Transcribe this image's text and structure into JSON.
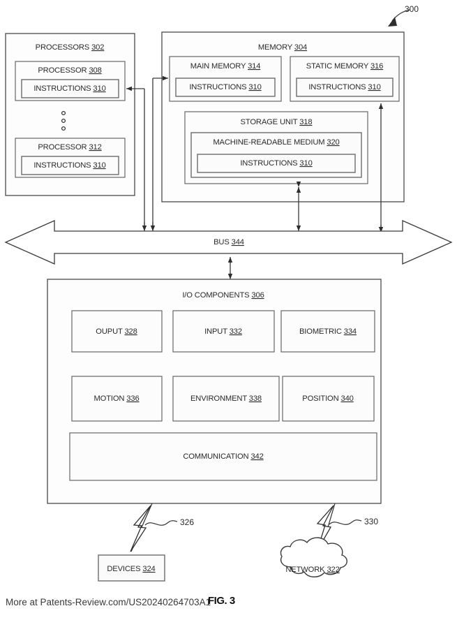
{
  "figure": {
    "id": "300",
    "caption": "FIG. 3",
    "footer_text": "More at Patents-Review.com/US20240264703A1"
  },
  "processors": {
    "title": "PROCESSORS",
    "num": "302",
    "items": [
      {
        "title": "PROCESSOR",
        "num": "308",
        "child": {
          "title": "INSTRUCTIONS",
          "num": "310"
        }
      },
      {
        "title": "PROCESSOR",
        "num": "312",
        "child": {
          "title": "INSTRUCTIONS",
          "num": "310"
        }
      }
    ],
    "ellipsis": "vertical-ellipsis"
  },
  "memory": {
    "title": "MEMORY",
    "num": "304",
    "main_memory": {
      "title": "MAIN MEMORY",
      "num": "314",
      "child": {
        "title": "INSTRUCTIONS",
        "num": "310"
      }
    },
    "static_memory": {
      "title": "STATIC MEMORY",
      "num": "316",
      "child": {
        "title": "INSTRUCTIONS",
        "num": "310"
      }
    },
    "storage_unit": {
      "title": "STORAGE UNIT",
      "num": "318",
      "medium": {
        "title": "MACHINE-READABLE MEDIUM",
        "num": "320",
        "child": {
          "title": "INSTRUCTIONS",
          "num": "310"
        }
      }
    }
  },
  "bus": {
    "title": "BUS",
    "num": "344"
  },
  "io": {
    "title": "I/O COMPONENTS",
    "num": "306",
    "row1": [
      {
        "title": "OUPUT",
        "num": "328"
      },
      {
        "title": "INPUT",
        "num": "332"
      },
      {
        "title": "BIOMETRIC",
        "num": "334"
      }
    ],
    "row2": [
      {
        "title": "MOTION",
        "num": "336"
      },
      {
        "title": "ENVIRONMENT",
        "num": "338"
      },
      {
        "title": "POSITION",
        "num": "340"
      }
    ],
    "row3": [
      {
        "title": "COMMUNICATION",
        "num": "342"
      }
    ]
  },
  "external": {
    "devices": {
      "title": "DEVICES",
      "num": "324",
      "link_ref": "326"
    },
    "network": {
      "title": "NETWORK",
      "num": "322",
      "link_ref": "330"
    }
  }
}
